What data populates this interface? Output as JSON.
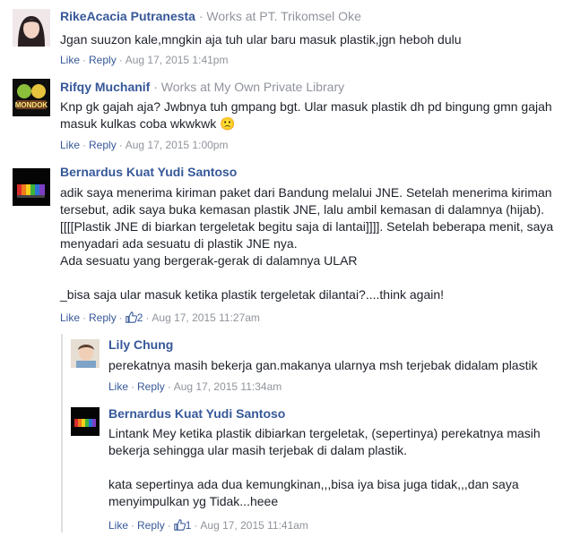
{
  "comments": [
    {
      "author": "RikeAcacia Putranesta",
      "work": " · Works at PT. Trikomsel Oke",
      "text": "Jgan suuzon kale,mngkin aja tuh ular baru masuk plastik,jgn heboh dulu",
      "like": "Like",
      "reply": "Reply",
      "time": "Aug 17, 2015 1:41pm"
    },
    {
      "author": "Rifqy Muchanif",
      "work": " · Works at My Own Private Library",
      "text": "Knp gk gajah aja? Jwbnya tuh gmpang bgt. Ular masuk plastik dh pd bingung gmn gajah\nmasuk kulkas coba wkwkwk 🙁",
      "like": "Like",
      "reply": "Reply",
      "time": "Aug 17, 2015 1:00pm",
      "avatar_text": "MONDOK"
    },
    {
      "author": "Bernardus Kuat Yudi Santoso",
      "text": "adik saya menerima kiriman paket dari Bandung melalui JNE. Setelah menerima kiriman\ntersebut, adik saya buka kemasan plastik JNE, lalu ambil kemasan di dalamnya (hijab).\n[[[[Plastik JNE di biarkan tergeletak begitu saja di lantai]]]]. Setelah beberapa menit, saya\nmenyadari ada sesuatu di plastik JNE nya.\nAda sesuatu yang bergerak-gerak di dalamnya ULAR\n\n_bisa saja ular masuk ketika plastik tergeletak dilantai?....think again!",
      "like": "Like",
      "reply": "Reply",
      "likes": "2",
      "time": "Aug 17, 2015 11:27am"
    },
    {
      "author": "Lily Chung",
      "text": "perekatnya masih bekerja gan.makanya ularnya msh terjebak didalam plastik",
      "like": "Like",
      "reply": "Reply",
      "time": "Aug 17, 2015 11:34am"
    },
    {
      "author": "Bernardus Kuat Yudi Santoso",
      "text": "Lintank Mey ketika plastik dibiarkan tergeletak, (sepertinya) perekatnya masih\nbekerja sehingga ular masih terjebak di dalam plastik.\n\nkata sepertinya ada dua kemungkinan,,,bisa iya bisa juga tidak,,,dan saya\nmenyimpulkan yg Tidak...heee",
      "like": "Like",
      "reply": "Reply",
      "likes": "1",
      "time": "Aug 17, 2015 11:41am"
    }
  ],
  "colors": {
    "link": "#365899",
    "meta": "#90949c",
    "text": "#1d2129"
  }
}
